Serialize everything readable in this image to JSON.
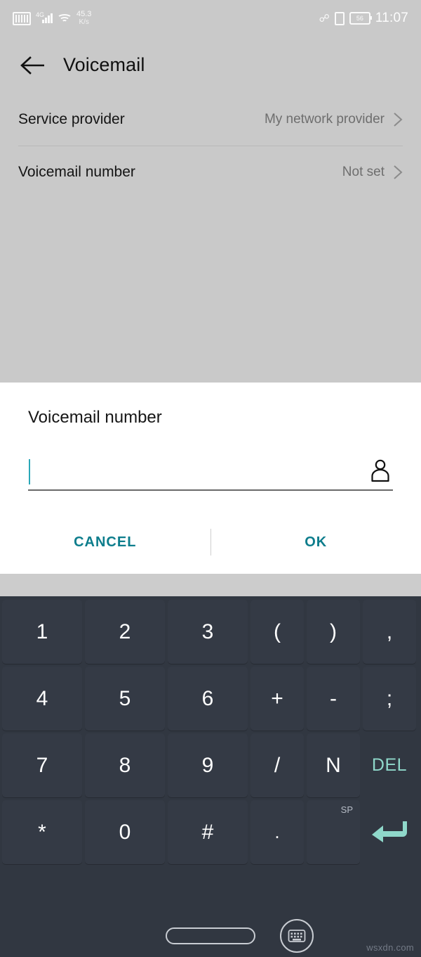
{
  "status_bar": {
    "sim_icon": "sim-card-icon",
    "network_type": "4G",
    "signal_icon": "signal-bars-icon",
    "wifi_icon": "wifi-icon",
    "net_speed_value": "45.3",
    "net_speed_unit": "K/s",
    "bluetooth_icon": "bluetooth-icon",
    "vibrate_icon": "vibrate-icon",
    "battery_level": "56",
    "time": "11:07"
  },
  "app_bar": {
    "back_icon": "back-arrow-icon",
    "title": "Voicemail"
  },
  "settings": {
    "rows": [
      {
        "label": "Service provider",
        "value": "My network provider",
        "chevron": "chevron-right-icon"
      },
      {
        "label": "Voicemail number",
        "value": "Not set",
        "chevron": "chevron-right-icon"
      }
    ]
  },
  "dialog": {
    "title": "Voicemail number",
    "input_value": "",
    "input_placeholder": "",
    "contact_icon": "contact-person-icon",
    "cancel_label": "CANCEL",
    "ok_label": "OK",
    "accent_color": "#0d7d8c",
    "caret_color": "#2aa8b8"
  },
  "keyboard": {
    "accent_color": "#8fd8ca",
    "background_color": "#313741",
    "key_color": "#343a45",
    "rows": [
      [
        {
          "label": "1",
          "type": "num"
        },
        {
          "label": "2",
          "type": "num"
        },
        {
          "label": "3",
          "type": "num"
        },
        {
          "label": "(",
          "type": "sym"
        },
        {
          "label": ")",
          "type": "sym"
        },
        {
          "label": ",",
          "type": "sym"
        }
      ],
      [
        {
          "label": "4",
          "type": "num"
        },
        {
          "label": "5",
          "type": "num"
        },
        {
          "label": "6",
          "type": "num"
        },
        {
          "label": "+",
          "type": "sym"
        },
        {
          "label": "-",
          "type": "sym"
        },
        {
          "label": ";",
          "type": "sym"
        }
      ],
      [
        {
          "label": "7",
          "type": "num"
        },
        {
          "label": "8",
          "type": "num"
        },
        {
          "label": "9",
          "type": "num"
        },
        {
          "label": "/",
          "type": "sym"
        },
        {
          "label": "N",
          "type": "sym"
        },
        {
          "label": "DEL",
          "type": "del"
        }
      ],
      [
        {
          "label": "*",
          "type": "num"
        },
        {
          "label": "0",
          "type": "num"
        },
        {
          "label": "#",
          "type": "num"
        },
        {
          "label": ".",
          "type": "sym"
        },
        {
          "label": "",
          "sup": "SP",
          "type": "space"
        },
        {
          "label": "",
          "type": "enter",
          "icon": "enter-key-icon"
        }
      ]
    ]
  },
  "nav_bar": {
    "home_indicator": "home-pill-indicator",
    "hide_keyboard_icon": "hide-keyboard-icon"
  },
  "watermark": "wsxdn.com"
}
